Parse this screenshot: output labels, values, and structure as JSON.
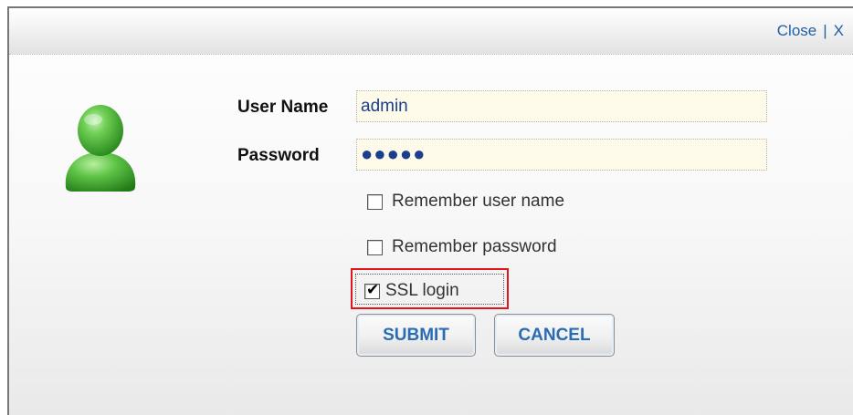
{
  "header": {
    "close_label": "Close",
    "separator": "|",
    "close_x": "X"
  },
  "avatar_icon": "user-avatar-icon",
  "form": {
    "username_label": "User Name",
    "username_value": "admin",
    "password_label": "Password",
    "password_value": "●●●●●",
    "remember_user": {
      "label": "Remember user name",
      "checked": false
    },
    "remember_password": {
      "label": "Remember password",
      "checked": false
    },
    "ssl_login": {
      "label": "SSL login",
      "checked": true
    }
  },
  "buttons": {
    "submit": "SUBMIT",
    "cancel": "CANCEL"
  },
  "colors": {
    "link": "#1f5fa8",
    "input_bg": "#fdfaea",
    "highlight": "#e4141d",
    "button_text": "#2a6bb3"
  }
}
